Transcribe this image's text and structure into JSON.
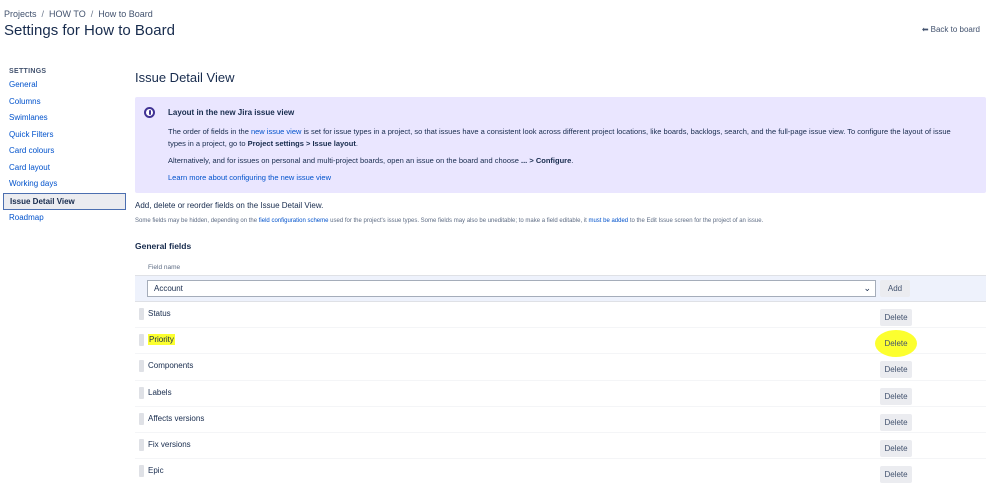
{
  "breadcrumbs": {
    "items": [
      "Projects",
      "HOW TO",
      "How to Board"
    ],
    "separator": "/"
  },
  "page_title": "Settings for How to Board",
  "back_link": {
    "arrow": "⬅",
    "label": "Back to board"
  },
  "sidebar": {
    "heading": "SETTINGS",
    "items": [
      {
        "label": "General"
      },
      {
        "label": "Columns"
      },
      {
        "label": "Swimlanes"
      },
      {
        "label": "Quick Filters"
      },
      {
        "label": "Card colours"
      },
      {
        "label": "Card layout"
      },
      {
        "label": "Working days"
      },
      {
        "label": "Issue Detail View",
        "active": true
      },
      {
        "label": "Roadmap"
      }
    ]
  },
  "main": {
    "title": "Issue Detail View",
    "info": {
      "title": "Layout in the new Jira issue view",
      "p1_a": "The order of fields in the ",
      "p1_link": "new issue view",
      "p1_b": " is set for issue types in a project, so that issues have a consistent look across different project locations, like boards, backlogs, search, and the full-page issue view. To configure the layout of issue types in a project, go to ",
      "p1_bold1": "Project settings",
      "p1_c": " > ",
      "p1_bold2": "Issue layout",
      "p1_d": ".",
      "p2_a": "Alternatively, and for issues on personal and multi-project boards, open an issue on the board and choose ",
      "p2_bold1": "...",
      "p2_b": " > ",
      "p2_bold2": "Configure",
      "p2_c": ".",
      "learn_more": "Learn more about configuring the new issue view"
    },
    "intro": "Add, delete or reorder fields on the Issue Detail View.",
    "hint": {
      "a": "Some fields may be hidden, depending on the ",
      "link1": "field configuration scheme",
      "b": " used for the project's issue types. Some fields may also be uneditable; to make a field editable, it ",
      "link2": "must be added",
      "c": " to the Edit Issue screen for the project of an issue."
    },
    "general_fields": {
      "title": "General fields",
      "column_header": "Field name",
      "select_value": "Account",
      "add_label": "Add",
      "delete_label": "Delete",
      "rows": [
        {
          "name": "Status"
        },
        {
          "name": "Priority",
          "highlighted": true
        },
        {
          "name": "Components"
        },
        {
          "name": "Labels"
        },
        {
          "name": "Affects versions"
        },
        {
          "name": "Fix versions"
        },
        {
          "name": "Epic"
        }
      ]
    }
  },
  "colors": {
    "link": "#0052cc",
    "info_bg": "#eae6ff",
    "highlight": "#fcff2f",
    "active_border": "#4c6fb0"
  }
}
